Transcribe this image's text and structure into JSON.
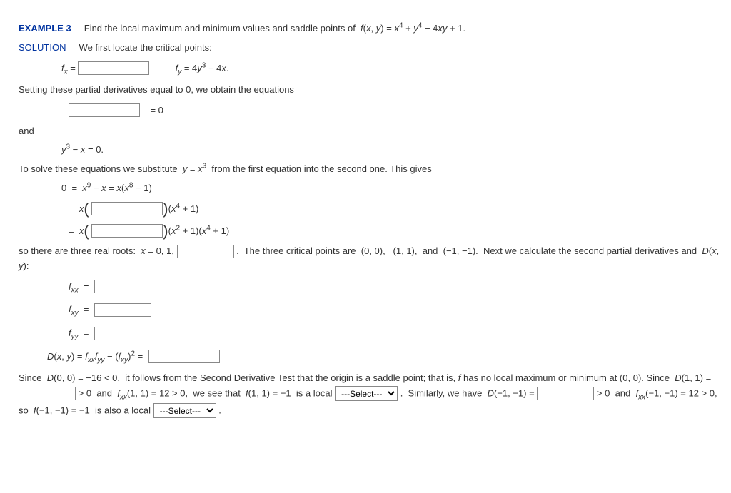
{
  "example": {
    "label": "EXAMPLE 3",
    "text": "Find the local maximum and minimum values and saddle points of  f(x, y)  =  x⁴ + y⁴ − 4xy + 1."
  },
  "solution_label": "SOLUTION",
  "line_intro": "We first locate the critical points:",
  "fx_eq": "fₓ =",
  "fy_eq": "f_y  =  4y³ − 4x.",
  "setting": "Setting these partial derivatives equal to 0, we obtain the equations",
  "eq_zero": "=  0",
  "and": "and",
  "y3": "y³ − x = 0.",
  "subst": "To solve these equations we substitute  y  =  x³  from the first equation into the second one. This gives",
  "eqA": "0  =  x⁹ − x  =  x(x⁸ − 1)",
  "eqB_pre": "=  x",
  "eqB_post": "(x⁴ + 1)",
  "eqC_pre": "=  x",
  "eqC_post": "(x² + 1)(x⁴ + 1)",
  "roots_pre": "so there are three real roots:  x  =  0, 1,",
  "roots_post": ".  The three critical points are  (0, 0),   (1, 1),  and  (−1, −1).  Next we calculate the second partial derivatives and  D(x, y):",
  "fxx": "fₓₓ  =",
  "fxy": "fₓ_y  =",
  "fyy": "f_yy  =",
  "Dxy": "D(x, y)  =  fₓₓf_yy  −  (fₓ_y)²  =",
  "p1": "Since  D(0, 0)  =  −16 < 0,  it follows from the Second Derivative Test that the origin is a saddle point; that is, f has no local maximum or minimum at (0, 0). Since  D(1, 1)  =",
  "p2": " > 0  and  fₓₓ(1, 1)  =  12 > 0,  we see that  f(1, 1)  =  −1  is a local ",
  "p3": ".  Similarly, we have  D(−1, −1)  =",
  "p4": " > 0  and  fₓₓ(−1, −1)  =  12 > 0,  so  f(−1, −1)  =  −1  is also a local ",
  "p5": ".",
  "select_placeholder": "---Select---"
}
